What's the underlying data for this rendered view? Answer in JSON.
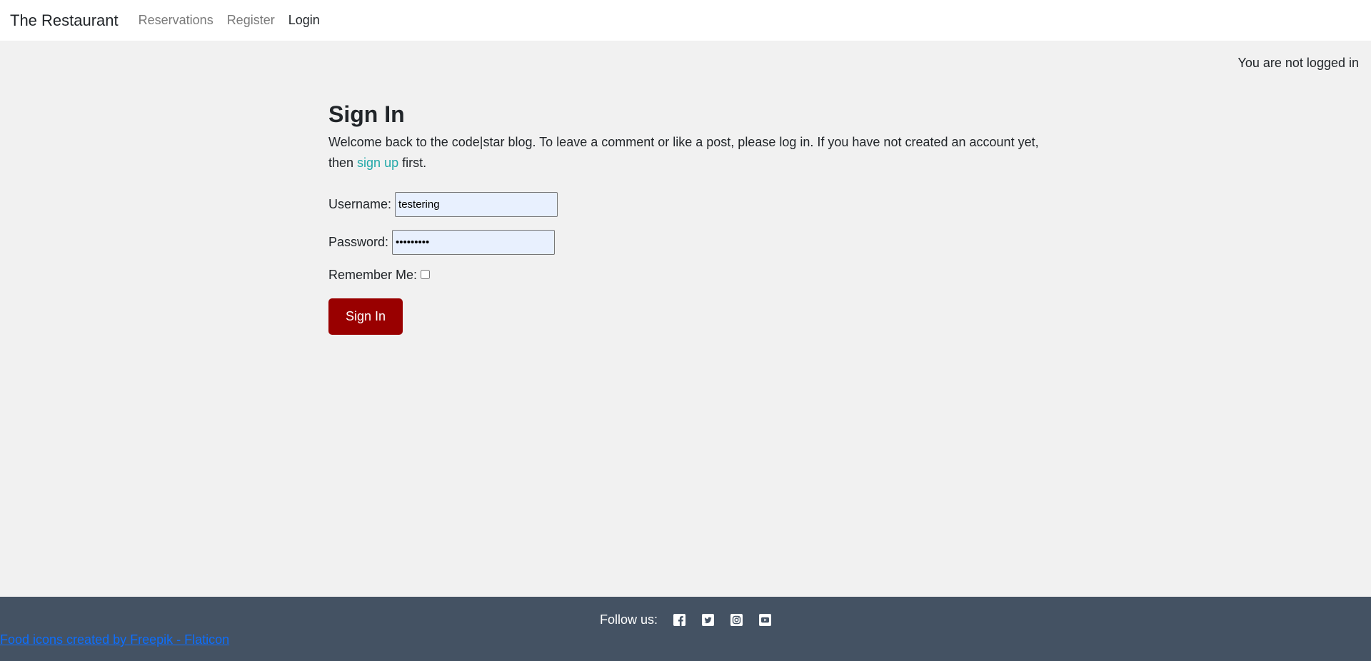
{
  "nav": {
    "brand": "The Restaurant",
    "links": [
      "Reservations",
      "Register",
      "Login"
    ]
  },
  "status": "You are not logged in",
  "page": {
    "title": "Sign In",
    "intro_before": "Welcome back to the code|star blog. To leave a comment or like a post, please log in. If you have not created an account yet, then ",
    "signup_link": "sign up",
    "intro_after": " first."
  },
  "form": {
    "username_label": "Username:",
    "username_value": "testering",
    "password_label": "Password:",
    "password_value": "•••••••••",
    "remember_label": "Remember Me:",
    "remember_checked": false,
    "submit_label": "Sign In"
  },
  "footer": {
    "follow_label": "Follow us:",
    "social_icons": [
      "facebook-icon",
      "twitter-icon",
      "instagram-icon",
      "youtube-icon"
    ],
    "credit": "Food icons created by Freepik - Flaticon"
  },
  "colors": {
    "button": "#990000",
    "footer": "#445263",
    "link_accent": "#20a8a8"
  }
}
